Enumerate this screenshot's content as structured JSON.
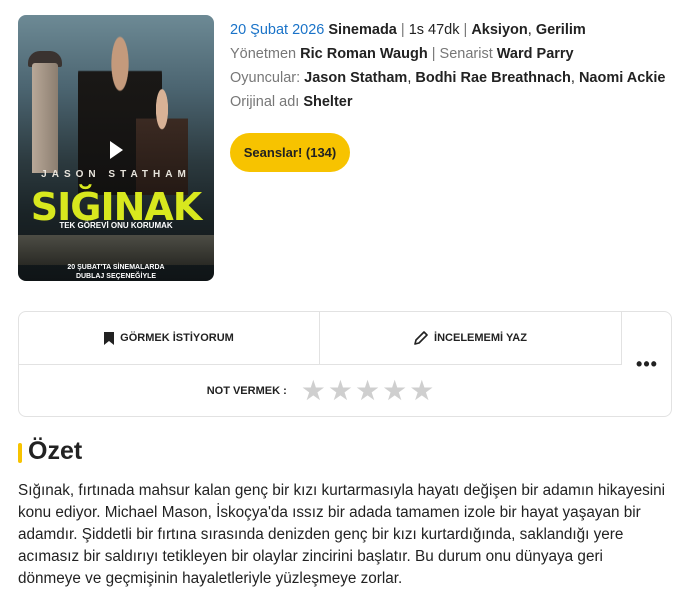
{
  "poster": {
    "actor_text": "JASON STATHAM",
    "title_text": "SIĞINAK",
    "tagline": "TEK GÖREVİ ONU KORUMAK",
    "date_line1": "20 ŞUBAT'TA SİNEMALARDA",
    "date_line2": "DUBLAJ SEÇENEĞİYLE"
  },
  "info": {
    "date": "20 Şubat 2026",
    "status": "Sinemada",
    "duration": "1s 47dk",
    "genres": [
      "Aksiyon",
      "Gerilim"
    ],
    "director_label": "Yönetmen",
    "director": "Ric Roman Waugh",
    "writer_label": "Senarist",
    "writer": "Ward Parry",
    "cast_label": "Oyuncular:",
    "cast": [
      "Jason Statham",
      "Bodhi Rae Breathnach",
      "Naomi Ackie"
    ],
    "original_label": "Orijinal adı",
    "original_title": "Shelter"
  },
  "seans_button": "Seanslar! (134)",
  "actions": {
    "watchlist": "GÖRMEK İSTİYORUM",
    "review": "İNCELEMEMİ YAZ",
    "more": "•••",
    "rating_label": "NOT VERMEK :"
  },
  "rating": {
    "value": 0,
    "max": 5
  },
  "summary": {
    "heading": "Özet",
    "text": "Sığınak, fırtınada mahsur kalan genç bir kızı kurtarmasıyla hayatı değişen bir adamın hikayesini konu ediyor. Michael Mason, İskoçya'da ıssız bir adada tamamen izole bir hayat yaşayan bir adamdır. Şiddetli bir fırtına sırasında denizden genç bir kızı kurtardığında, saklandığı yere acımasız bir saldırıyı tetikleyen bir olaylar zincirini başlatır. Bu durum onu dünyaya geri dönmeye ve geçmişinin hayaletleriyle yüzleşmeye zorlar."
  },
  "colors": {
    "accent": "#f7c300",
    "date": "#1a73c8"
  }
}
